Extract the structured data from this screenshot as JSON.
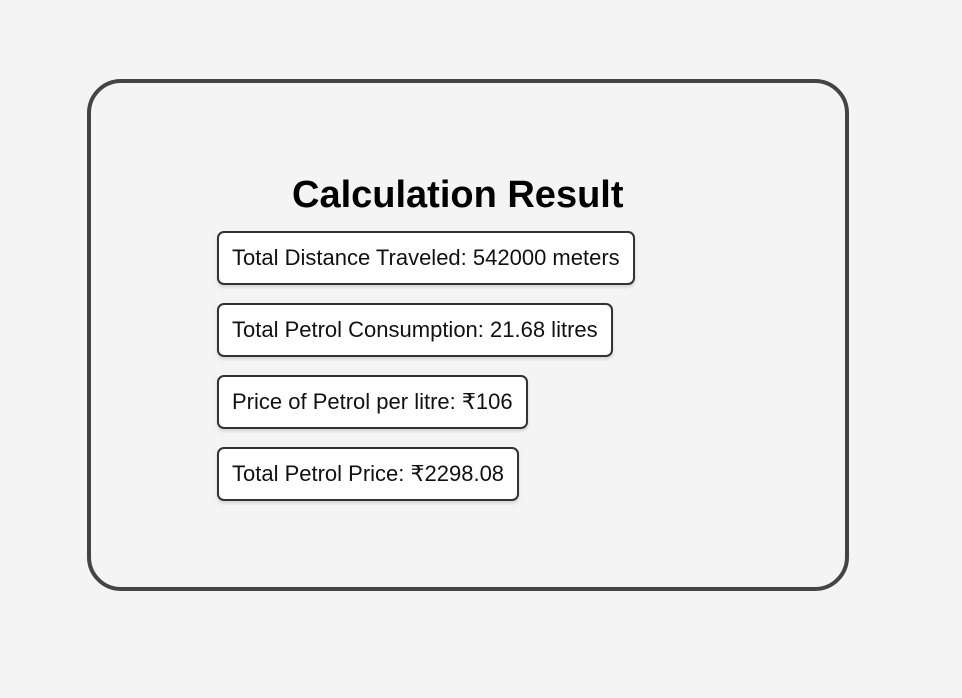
{
  "title": "Calculation Result",
  "results": [
    "Total Distance Traveled: 542000 meters",
    "Total Petrol Consumption: 21.68 litres",
    "Price of Petrol per litre: ₹106",
    "Total Petrol Price: ₹2298.08"
  ]
}
